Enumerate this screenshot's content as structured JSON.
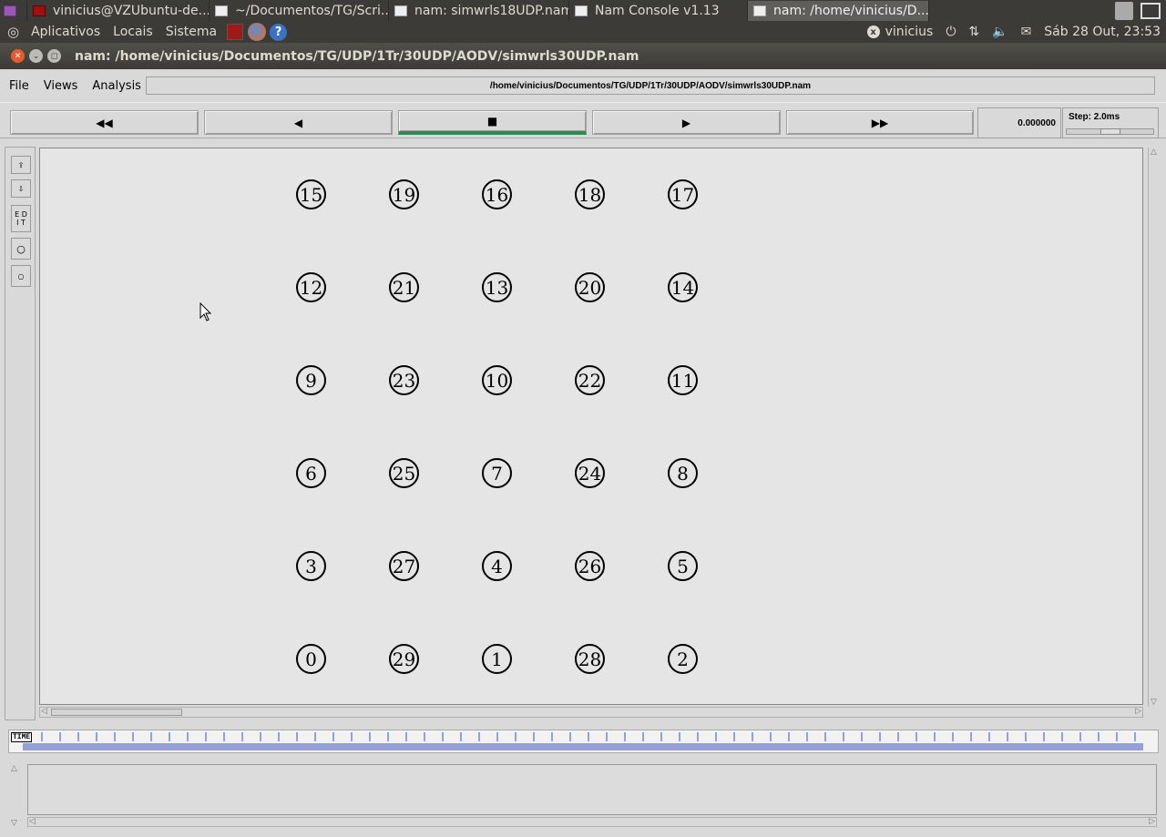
{
  "taskbar": {
    "tasks": [
      {
        "label": "vinicius@VZUbuntu-de...",
        "icon": "terminal-icon"
      },
      {
        "label": "~/Documentos/TG/Scri...",
        "icon": "file-manager-icon"
      },
      {
        "label": "nam: simwrls18UDP.nam",
        "icon": "window-icon"
      },
      {
        "label": "Nam Console v1.13",
        "icon": "window-icon"
      },
      {
        "label": "nam: /home/vinicius/D...",
        "icon": "window-icon"
      }
    ]
  },
  "panel": {
    "menus": [
      "Aplicativos",
      "Locais",
      "Sistema"
    ],
    "user": "vinicius",
    "clock": "Sáb 28 Out, 23:53"
  },
  "window": {
    "title": "nam: /home/vinicius/Documentos/TG/UDP/1Tr/30UDP/AODV/simwrls30UDP.nam"
  },
  "app": {
    "menu": [
      "File",
      "Views",
      "Analysis"
    ],
    "filepath": "/home/vinicius/Documentos/TG/UDP/1Tr/30UDP/AODV/simwrls30UDP.nam",
    "controls": {
      "rewind": "◀◀",
      "back": "◀",
      "stop": "■",
      "play": "▶",
      "fastforward": "▶▶"
    },
    "time_value": "0.000000",
    "step_label": "Step: 2.0ms",
    "step_slider_fraction": 0.5,
    "tools": {
      "edit": "E D\nI T"
    },
    "time_label": "TIME"
  },
  "nodes": [
    {
      "id": "15",
      "col": 0,
      "row": 0
    },
    {
      "id": "19",
      "col": 1,
      "row": 0
    },
    {
      "id": "16",
      "col": 2,
      "row": 0
    },
    {
      "id": "18",
      "col": 3,
      "row": 0
    },
    {
      "id": "17",
      "col": 4,
      "row": 0
    },
    {
      "id": "12",
      "col": 0,
      "row": 1
    },
    {
      "id": "21",
      "col": 1,
      "row": 1
    },
    {
      "id": "13",
      "col": 2,
      "row": 1
    },
    {
      "id": "20",
      "col": 3,
      "row": 1
    },
    {
      "id": "14",
      "col": 4,
      "row": 1
    },
    {
      "id": "9",
      "col": 0,
      "row": 2
    },
    {
      "id": "23",
      "col": 1,
      "row": 2
    },
    {
      "id": "10",
      "col": 2,
      "row": 2
    },
    {
      "id": "22",
      "col": 3,
      "row": 2
    },
    {
      "id": "11",
      "col": 4,
      "row": 2
    },
    {
      "id": "6",
      "col": 0,
      "row": 3
    },
    {
      "id": "25",
      "col": 1,
      "row": 3
    },
    {
      "id": "7",
      "col": 2,
      "row": 3
    },
    {
      "id": "24",
      "col": 3,
      "row": 3
    },
    {
      "id": "8",
      "col": 4,
      "row": 3
    },
    {
      "id": "3",
      "col": 0,
      "row": 4
    },
    {
      "id": "27",
      "col": 1,
      "row": 4
    },
    {
      "id": "4",
      "col": 2,
      "row": 4
    },
    {
      "id": "26",
      "col": 3,
      "row": 4
    },
    {
      "id": "5",
      "col": 4,
      "row": 4
    },
    {
      "id": "0",
      "col": 0,
      "row": 5
    },
    {
      "id": "29",
      "col": 1,
      "row": 5
    },
    {
      "id": "1",
      "col": 2,
      "row": 5
    },
    {
      "id": "28",
      "col": 3,
      "row": 5
    },
    {
      "id": "2",
      "col": 4,
      "row": 5
    }
  ]
}
